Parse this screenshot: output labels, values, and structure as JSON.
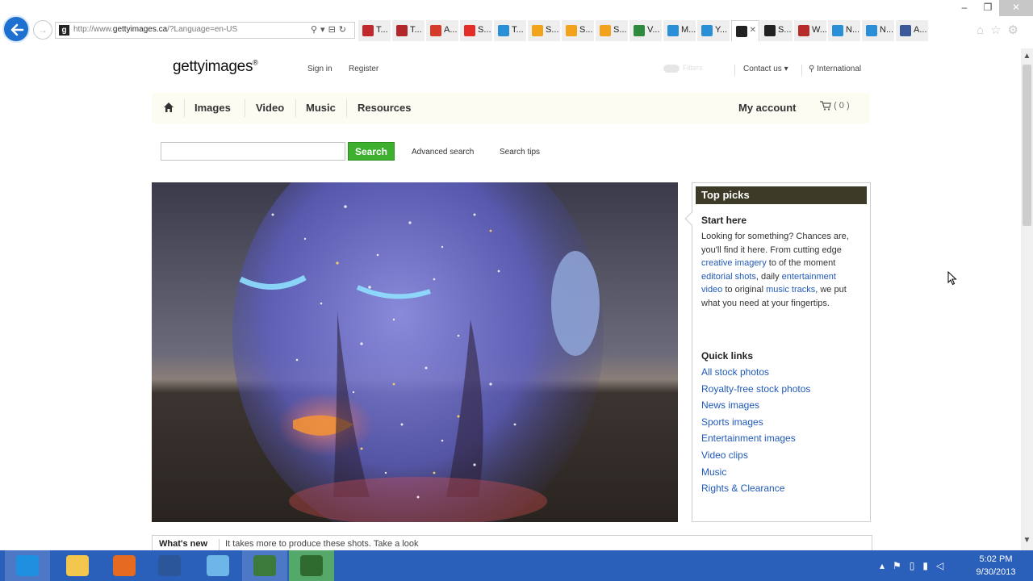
{
  "browser": {
    "url": "http://www.gettyimages.ca/?Language=en-US",
    "url_prefix": "http://www.",
    "url_host": "gettyimages.ca",
    "url_suffix": "/?Language=en-US",
    "tabs": [
      {
        "label": "T...",
        "icon": "red-favicon",
        "color": "#c0282b"
      },
      {
        "label": "T...",
        "icon": "red-favicon",
        "color": "#b3262a"
      },
      {
        "label": "A...",
        "icon": "acrobat-icon",
        "color": "#d63a2a"
      },
      {
        "label": "S...",
        "icon": "youtube-icon",
        "color": "#e52d27"
      },
      {
        "label": "T...",
        "icon": "ie-page-icon",
        "color": "#2b8fd8"
      },
      {
        "label": "S...",
        "icon": "multicolor-grid-icon",
        "color": "#f2a31b"
      },
      {
        "label": "S...",
        "icon": "multicolor-grid-icon",
        "color": "#f2a31b"
      },
      {
        "label": "S...",
        "icon": "multicolor-grid-icon",
        "color": "#f2a31b"
      },
      {
        "label": "V...",
        "icon": "vine-icon",
        "color": "#2e8b3e"
      },
      {
        "label": "M...",
        "icon": "ie-page-icon",
        "color": "#2b8fd8"
      },
      {
        "label": "Y...",
        "icon": "ie-page-icon",
        "color": "#2b8fd8"
      },
      {
        "label": "",
        "icon": "gettyimages-favicon",
        "color": "#222222",
        "active": true
      },
      {
        "label": "S...",
        "icon": "gettyimages-favicon",
        "color": "#222222"
      },
      {
        "label": "W...",
        "icon": "red-box-icon",
        "color": "#b82b2b"
      },
      {
        "label": "N...",
        "icon": "ie-page-icon",
        "color": "#2b8fd8"
      },
      {
        "label": "N...",
        "icon": "ie-page-icon",
        "color": "#2b8fd8"
      },
      {
        "label": "A...",
        "icon": "facebook-icon",
        "color": "#3b5998"
      }
    ]
  },
  "header": {
    "logo_text": "gettyimages",
    "logo_mark": "®",
    "sign_in": "Sign in",
    "register": "Register",
    "toggle_label": "Filters",
    "contact_us": "Contact us ▾",
    "international": "International"
  },
  "nav": {
    "items": [
      "Images",
      "Video",
      "Music",
      "Resources"
    ],
    "my_account": "My account",
    "cart_count": "( 0 )"
  },
  "search": {
    "placeholder": "",
    "button_label": "Search",
    "advanced": "Advanced search",
    "tips": "Search tips"
  },
  "top_picks": {
    "title": "Top picks",
    "start_here": "Start here",
    "intro": [
      {
        "text": "Looking for something? Chances are, you'll find it here. From cutting edge "
      },
      {
        "text": "creative imagery",
        "link": true
      },
      {
        "text": " to of the moment "
      },
      {
        "text": "editorial shots",
        "link": true
      },
      {
        "text": ", daily "
      },
      {
        "text": "entertainment video",
        "link": true
      },
      {
        "text": " to original "
      },
      {
        "text": "music tracks",
        "link": true
      },
      {
        "text": ", we put what you need at your fingertips."
      }
    ],
    "quick_links_title": "Quick links",
    "quick_links": [
      "All stock photos",
      "Royalty-free stock photos",
      "News images",
      "Sports images",
      "Entertainment images",
      "Video clips",
      "Music",
      "Rights & Clearance"
    ]
  },
  "whats_new": {
    "label": "What's new",
    "text": "It takes more to produce these shots. Take a look"
  },
  "taskbar": {
    "apps": [
      {
        "name": "internet-explorer-icon",
        "color": "#1f8fe0"
      },
      {
        "name": "file-explorer-icon",
        "color": "#f3c74d"
      },
      {
        "name": "firefox-icon",
        "color": "#e66a1f"
      },
      {
        "name": "word-icon",
        "color": "#2b579a"
      },
      {
        "name": "notepad-icon",
        "color": "#6fb6e8"
      },
      {
        "name": "camtasia-recorder-icon",
        "color": "#3b7a3a"
      },
      {
        "name": "camtasia-studio-icon",
        "color": "#2f6b2e"
      }
    ],
    "time": "5:02 PM",
    "date": "9/30/2013"
  }
}
